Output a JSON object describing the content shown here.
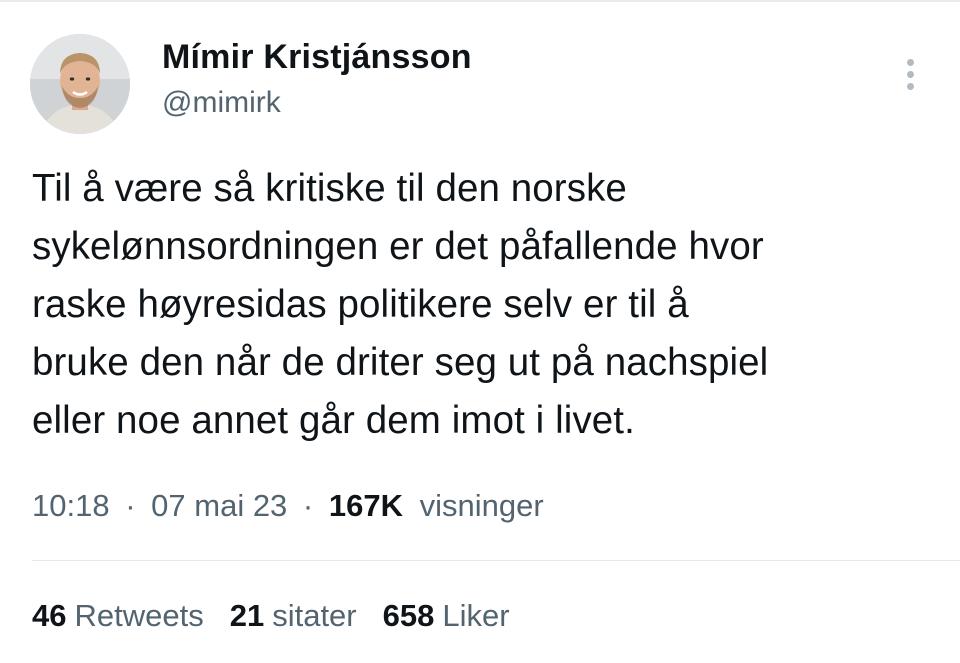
{
  "author": {
    "display_name": "Mímir Kristjánsson",
    "handle": "@mimirk"
  },
  "tweet": {
    "lines": [
      "Til å være så kritiske til den norske",
      "sykelønnsordningen er det påfallende hvor",
      "raske høyresidas politikere selv er til å",
      "bruke den når de driter seg ut på nachspiel",
      "eller noe annet går dem imot i livet."
    ]
  },
  "meta": {
    "time": "10:18",
    "separator": "·",
    "date": "07 mai 23",
    "views_count": "167K",
    "views_label": "visninger"
  },
  "stats": {
    "retweets_count": "46",
    "retweets_label": "Retweets",
    "quotes_count": "21",
    "quotes_label": "sitater",
    "likes_count": "658",
    "likes_label": "Liker"
  },
  "icons": {
    "more": "more-vertical-icon"
  },
  "colors": {
    "text_primary": "#0f1419",
    "text_secondary": "#536471",
    "divider": "#e6e9eb"
  }
}
